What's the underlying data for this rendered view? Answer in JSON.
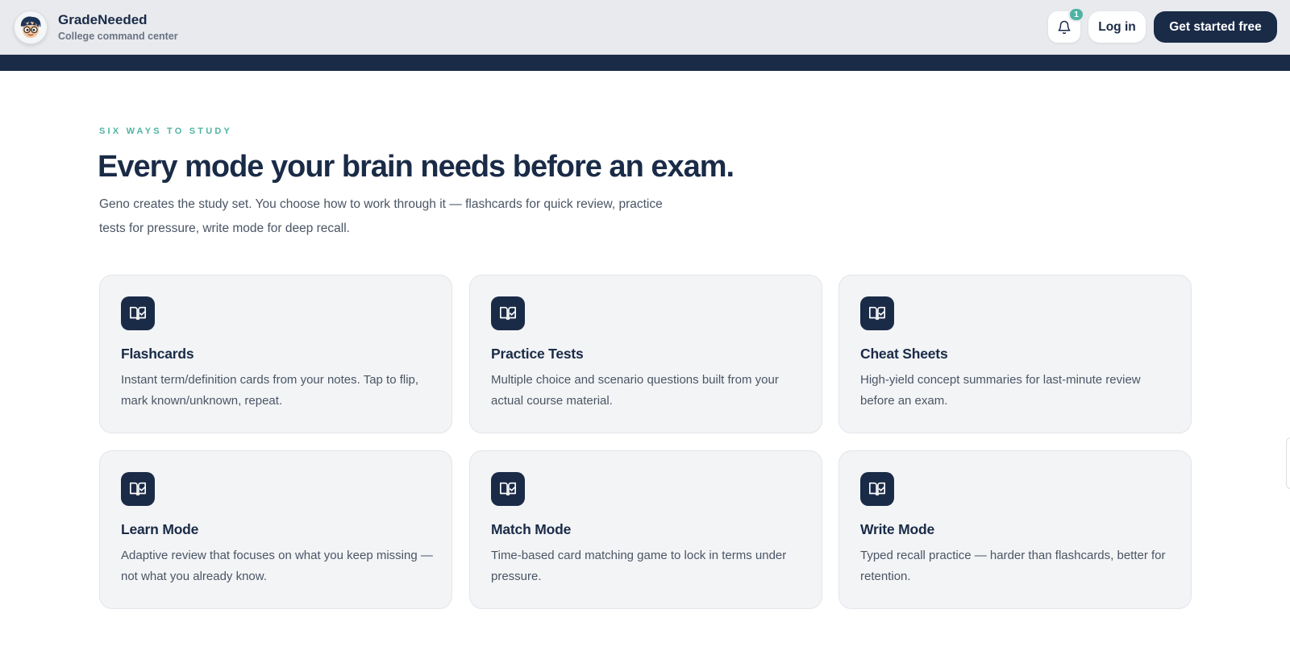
{
  "header": {
    "brand_name": "GradeNeeded",
    "brand_tagline": "College command center",
    "notification_count": "1",
    "login_label": "Log in",
    "cta_label": "Get started free"
  },
  "section": {
    "eyebrow": "SIX WAYS TO STUDY",
    "headline": "Every mode your brain needs before an exam.",
    "intro": "Geno creates the study set. You choose how to work through it — flashcards for quick review, practice tests for pressure, write mode for deep recall."
  },
  "modes": [
    {
      "icon": "book-check-icon",
      "title": "Flashcards",
      "desc": "Instant term/definition cards from your notes. Tap to flip, mark known/unknown, repeat."
    },
    {
      "icon": "book-check-icon",
      "title": "Practice Tests",
      "desc": "Multiple choice and scenario questions built from your actual course material."
    },
    {
      "icon": "book-check-icon",
      "title": "Cheat Sheets",
      "desc": "High-yield concept summaries for last-minute review before an exam."
    },
    {
      "icon": "book-check-icon",
      "title": "Learn Mode",
      "desc": "Adaptive review that focuses on what you keep missing — not what you already know."
    },
    {
      "icon": "book-check-icon",
      "title": "Match Mode",
      "desc": "Time-based card matching game to lock in terms under pressure."
    },
    {
      "icon": "book-check-icon",
      "title": "Write Mode",
      "desc": "Typed recall practice — harder than flashcards, better for retention."
    }
  ],
  "colors": {
    "navy": "#1a2b47",
    "accent_teal": "#4fb3a3",
    "header_bg": "#e8eaee",
    "card_bg": "#f3f4f6"
  }
}
